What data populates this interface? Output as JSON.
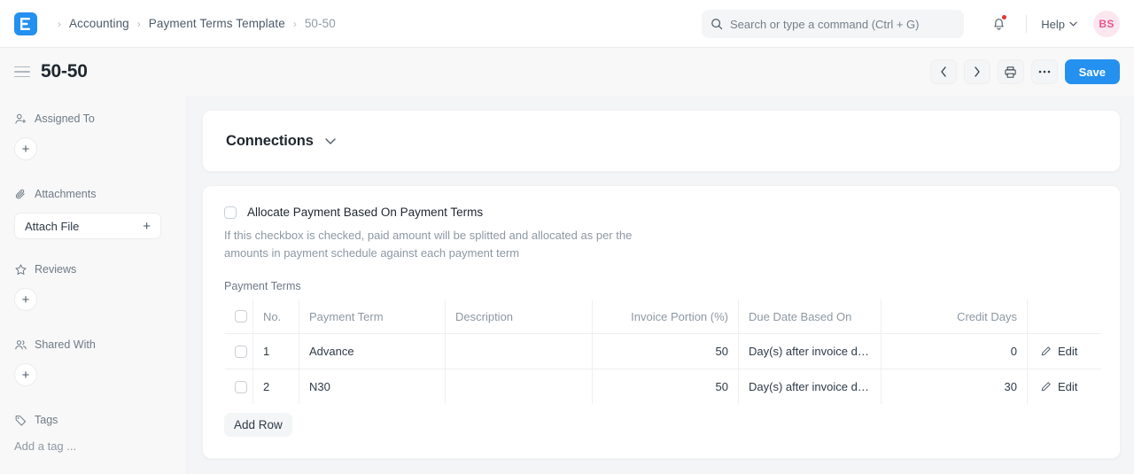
{
  "navbar": {
    "logo_icon": "frappe-logo-icon",
    "logo_color": "#2490EF",
    "breadcrumb": [
      "Accounting",
      "Payment Terms Template",
      "50-50"
    ],
    "search": {
      "icon": "search-icon",
      "placeholder": "Search or type a command (Ctrl + G)",
      "value": ""
    },
    "notifications": {
      "icon": "bell-icon",
      "has_unread": true,
      "dot_color": "#E03636"
    },
    "help": {
      "label": "Help",
      "icon": "chevron-down-icon"
    },
    "avatar": {
      "initials": "BS",
      "bg": "#FCE7EF",
      "fg": "#E8568E"
    }
  },
  "titlebar": {
    "menu_icon": "hamburger-icon",
    "title": "50-50",
    "actions": {
      "prev": "‹",
      "next": "›",
      "print_icon": "printer-icon",
      "more": "···",
      "save_label": "Save",
      "save_color": "#2490EF"
    }
  },
  "sidebar": {
    "sections": [
      {
        "label": "Assigned To",
        "icon": "user-plus-icon",
        "control": "add-circle-button"
      },
      {
        "label": "Attachments",
        "icon": "paperclip-icon",
        "control": "attach-file-button",
        "button_label": "Attach File",
        "button_icon": "plus-icon"
      },
      {
        "label": "Reviews",
        "icon": "star-icon",
        "control": "add-circle-button"
      },
      {
        "label": "Shared With",
        "icon": "users-icon",
        "control": "add-circle-button"
      },
      {
        "label": "Tags",
        "icon": "tag-icon",
        "control": "tag-input",
        "placeholder": "Add a tag ..."
      }
    ],
    "add_symbol": "+"
  },
  "main": {
    "connections": {
      "title": "Connections",
      "toggle_icon": "chevron-down-icon"
    },
    "allocate": {
      "checkbox_label": "Allocate Payment Based On Payment Terms",
      "checked": false,
      "description": "If this checkbox is checked, paid amount will be splitted and allocated as per the amounts in payment schedule against each payment term"
    },
    "payment_terms": {
      "section_label": "Payment Terms",
      "columns": [
        "",
        "No.",
        "Payment Term",
        "Description",
        "Invoice Portion (%)",
        "Due Date Based On",
        "Credit Days",
        ""
      ],
      "rows": [
        {
          "no": "1",
          "payment_term": "Advance",
          "description": "",
          "invoice_portion": "50",
          "due_date_based_on": "Day(s) after invoice da...",
          "credit_days": "0",
          "edit_label": "Edit",
          "edit_icon": "pencil-icon",
          "selected": false
        },
        {
          "no": "2",
          "payment_term": "N30",
          "description": "",
          "invoice_portion": "50",
          "due_date_based_on": "Day(s) after invoice da...",
          "credit_days": "30",
          "edit_label": "Edit",
          "edit_icon": "pencil-icon",
          "selected": false
        }
      ],
      "add_row_label": "Add Row"
    }
  }
}
